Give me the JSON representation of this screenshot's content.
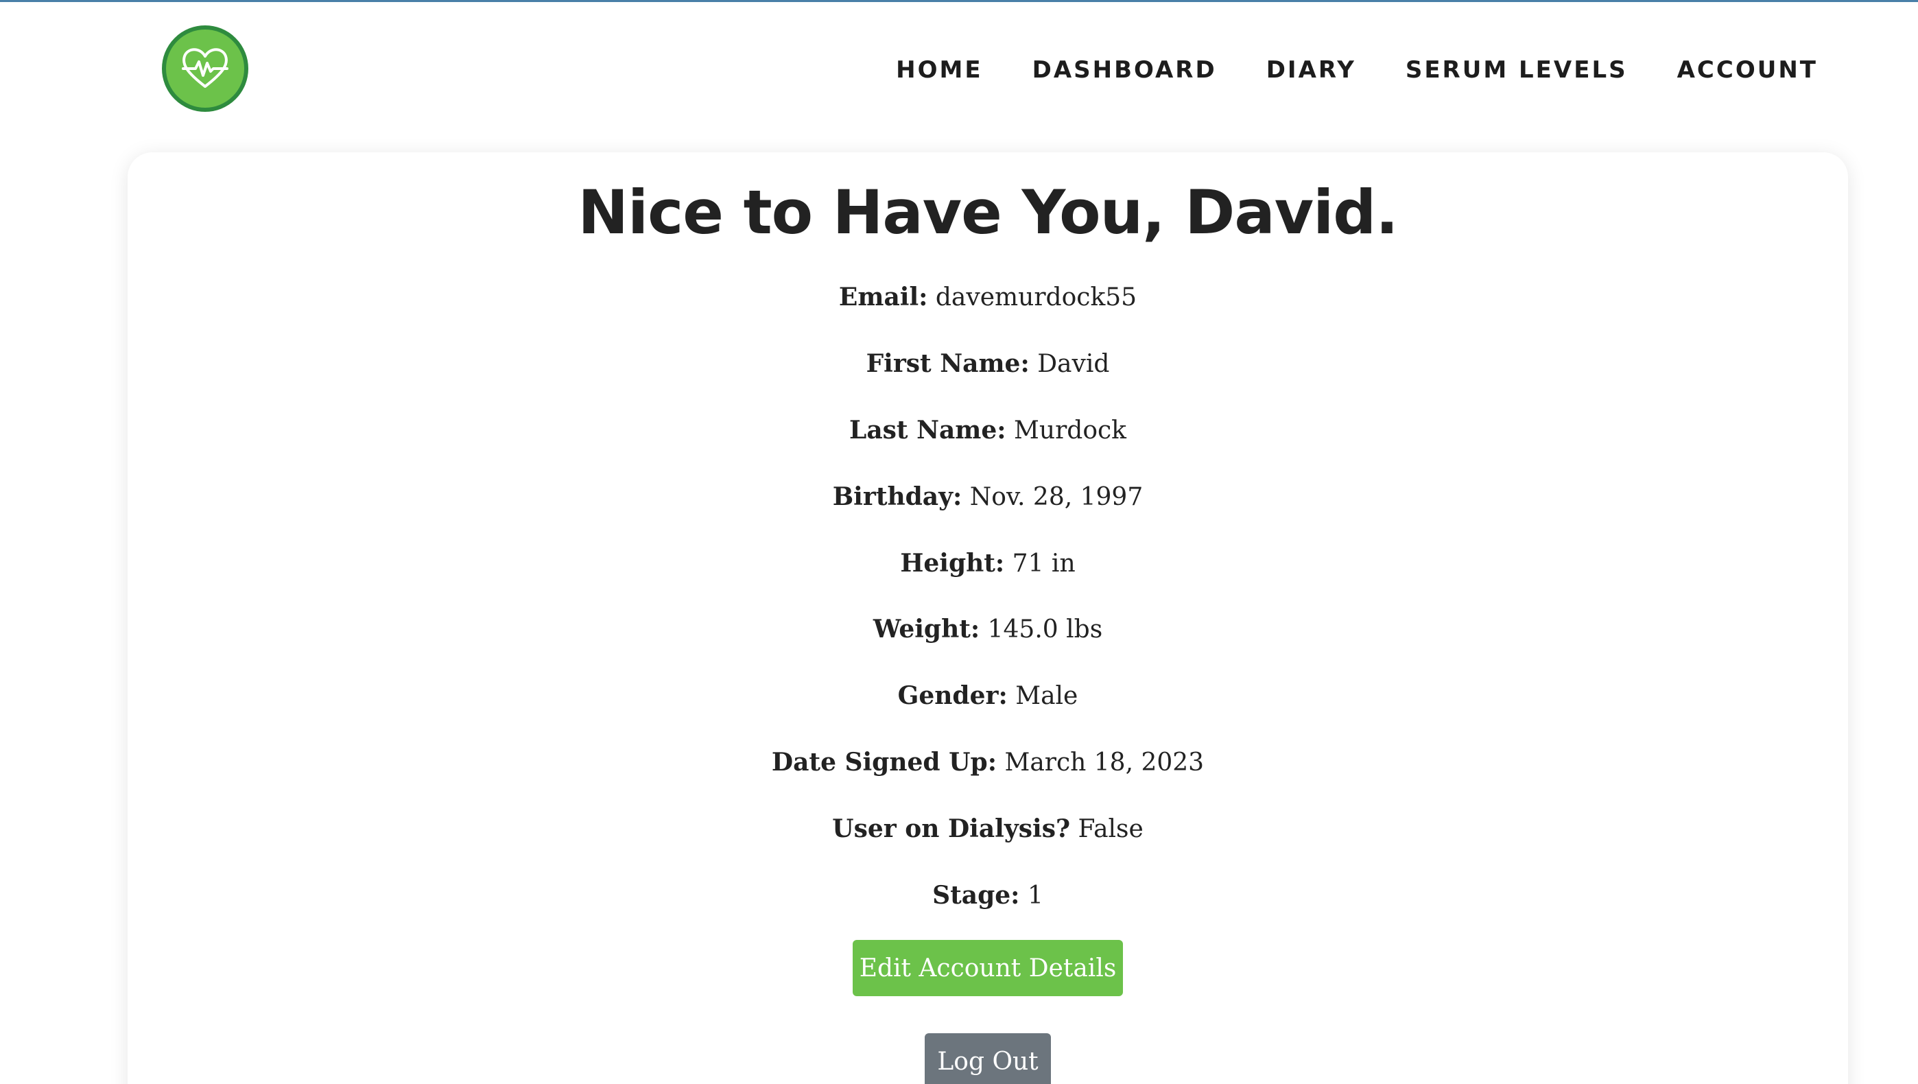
{
  "nav": {
    "items": [
      {
        "label": "HOME"
      },
      {
        "label": "DASHBOARD"
      },
      {
        "label": "DIARY"
      },
      {
        "label": "SERUM LEVELS"
      },
      {
        "label": "ACCOUNT"
      }
    ]
  },
  "logo": {
    "icon": "heart-pulse-icon",
    "fill_color": "#6cc24a",
    "ring_color": "#2e8b3e"
  },
  "account": {
    "greeting": "Nice to Have You, David.",
    "fields": [
      {
        "label": "Email:",
        "value": "davemurdock55"
      },
      {
        "label": "First Name:",
        "value": "David"
      },
      {
        "label": "Last Name:",
        "value": "Murdock"
      },
      {
        "label": "Birthday:",
        "value": "Nov. 28, 1997"
      },
      {
        "label": "Height:",
        "value": "71 in"
      },
      {
        "label": "Weight:",
        "value": "145.0 lbs"
      },
      {
        "label": "Gender:",
        "value": "Male"
      },
      {
        "label": "Date Signed Up:",
        "value": "March 18, 2023"
      },
      {
        "label": "User on Dialysis?",
        "value": "False"
      },
      {
        "label": "Stage:",
        "value": "1"
      }
    ],
    "edit_button": "Edit Account Details",
    "logout_button": "Log Out"
  },
  "colors": {
    "accent_green": "#6cc24a",
    "secondary_gray": "#6c757d",
    "text": "#222222"
  }
}
